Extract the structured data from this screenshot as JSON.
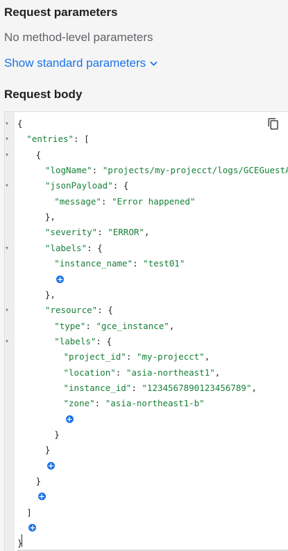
{
  "request_parameters": {
    "title": "Request parameters",
    "empty_text": "No method-level parameters",
    "show_standard_label": "Show standard parameters"
  },
  "request_body": {
    "title": "Request body"
  },
  "editor": {
    "add_glyph": "+",
    "lines": [
      {
        "indent": 0,
        "fold": true,
        "parts": [
          {
            "t": "p",
            "v": "{"
          }
        ]
      },
      {
        "indent": 1,
        "fold": true,
        "parts": [
          {
            "t": "k",
            "v": "\"entries\""
          },
          {
            "t": "p",
            "v": ": ["
          }
        ]
      },
      {
        "indent": 2,
        "fold": true,
        "parts": [
          {
            "t": "p",
            "v": "{"
          }
        ]
      },
      {
        "indent": 3,
        "fold": false,
        "parts": [
          {
            "t": "k",
            "v": "\"logName\""
          },
          {
            "t": "p",
            "v": ": "
          },
          {
            "t": "s",
            "v": "\"projects/my-projecct/logs/GCEGuestAgent\""
          }
        ]
      },
      {
        "indent": 3,
        "fold": true,
        "parts": [
          {
            "t": "k",
            "v": "\"jsonPayload\""
          },
          {
            "t": "p",
            "v": ": {"
          }
        ]
      },
      {
        "indent": 4,
        "fold": false,
        "parts": [
          {
            "t": "k",
            "v": "\"message\""
          },
          {
            "t": "p",
            "v": ": "
          },
          {
            "t": "s",
            "v": "\"Error happened\""
          }
        ]
      },
      {
        "indent": 3,
        "fold": false,
        "parts": [
          {
            "t": "p",
            "v": "},"
          }
        ]
      },
      {
        "indent": 3,
        "fold": false,
        "parts": [
          {
            "t": "k",
            "v": "\"severity\""
          },
          {
            "t": "p",
            "v": ": "
          },
          {
            "t": "s",
            "v": "\"ERROR\""
          },
          {
            "t": "p",
            "v": ","
          }
        ]
      },
      {
        "indent": 3,
        "fold": true,
        "parts": [
          {
            "t": "k",
            "v": "\"labels\""
          },
          {
            "t": "p",
            "v": ": {"
          }
        ]
      },
      {
        "indent": 4,
        "fold": false,
        "parts": [
          {
            "t": "k",
            "v": "\"instance_name\""
          },
          {
            "t": "p",
            "v": ": "
          },
          {
            "t": "s",
            "v": "\"test01\""
          }
        ]
      },
      {
        "indent": 4,
        "fold": false,
        "add": true,
        "parts": []
      },
      {
        "indent": 3,
        "fold": false,
        "parts": [
          {
            "t": "p",
            "v": "},"
          }
        ]
      },
      {
        "indent": 3,
        "fold": true,
        "parts": [
          {
            "t": "k",
            "v": "\"resource\""
          },
          {
            "t": "p",
            "v": ": {"
          }
        ]
      },
      {
        "indent": 4,
        "fold": false,
        "parts": [
          {
            "t": "k",
            "v": "\"type\""
          },
          {
            "t": "p",
            "v": ": "
          },
          {
            "t": "s",
            "v": "\"gce_instance\""
          },
          {
            "t": "p",
            "v": ","
          }
        ]
      },
      {
        "indent": 4,
        "fold": true,
        "parts": [
          {
            "t": "k",
            "v": "\"labels\""
          },
          {
            "t": "p",
            "v": ": {"
          }
        ]
      },
      {
        "indent": 5,
        "fold": false,
        "parts": [
          {
            "t": "k",
            "v": "\"project_id\""
          },
          {
            "t": "p",
            "v": ": "
          },
          {
            "t": "s",
            "v": "\"my-projecct\""
          },
          {
            "t": "p",
            "v": ","
          }
        ]
      },
      {
        "indent": 5,
        "fold": false,
        "parts": [
          {
            "t": "k",
            "v": "\"location\""
          },
          {
            "t": "p",
            "v": ": "
          },
          {
            "t": "s",
            "v": "\"asia-northeast1\""
          },
          {
            "t": "p",
            "v": ","
          }
        ]
      },
      {
        "indent": 5,
        "fold": false,
        "parts": [
          {
            "t": "k",
            "v": "\"instance_id\""
          },
          {
            "t": "p",
            "v": ": "
          },
          {
            "t": "s",
            "v": "\"1234567890123456789\""
          },
          {
            "t": "p",
            "v": ","
          }
        ]
      },
      {
        "indent": 5,
        "fold": false,
        "parts": [
          {
            "t": "k",
            "v": "\"zone\""
          },
          {
            "t": "p",
            "v": ": "
          },
          {
            "t": "s",
            "v": "\"asia-northeast1-b\""
          }
        ]
      },
      {
        "indent": 5,
        "fold": false,
        "add": true,
        "parts": []
      },
      {
        "indent": 4,
        "fold": false,
        "parts": [
          {
            "t": "p",
            "v": "}"
          }
        ]
      },
      {
        "indent": 3,
        "fold": false,
        "parts": [
          {
            "t": "p",
            "v": "}"
          }
        ]
      },
      {
        "indent": 3,
        "fold": false,
        "add": true,
        "parts": []
      },
      {
        "indent": 2,
        "fold": false,
        "parts": [
          {
            "t": "p",
            "v": "}"
          }
        ]
      },
      {
        "indent": 2,
        "fold": false,
        "add": true,
        "parts": []
      },
      {
        "indent": 1,
        "fold": false,
        "parts": [
          {
            "t": "p",
            "v": "]"
          }
        ]
      },
      {
        "indent": 1,
        "fold": false,
        "add": true,
        "parts": []
      },
      {
        "indent": 0,
        "fold": false,
        "parts": [
          {
            "t": "p",
            "v": "}"
          }
        ]
      }
    ]
  }
}
